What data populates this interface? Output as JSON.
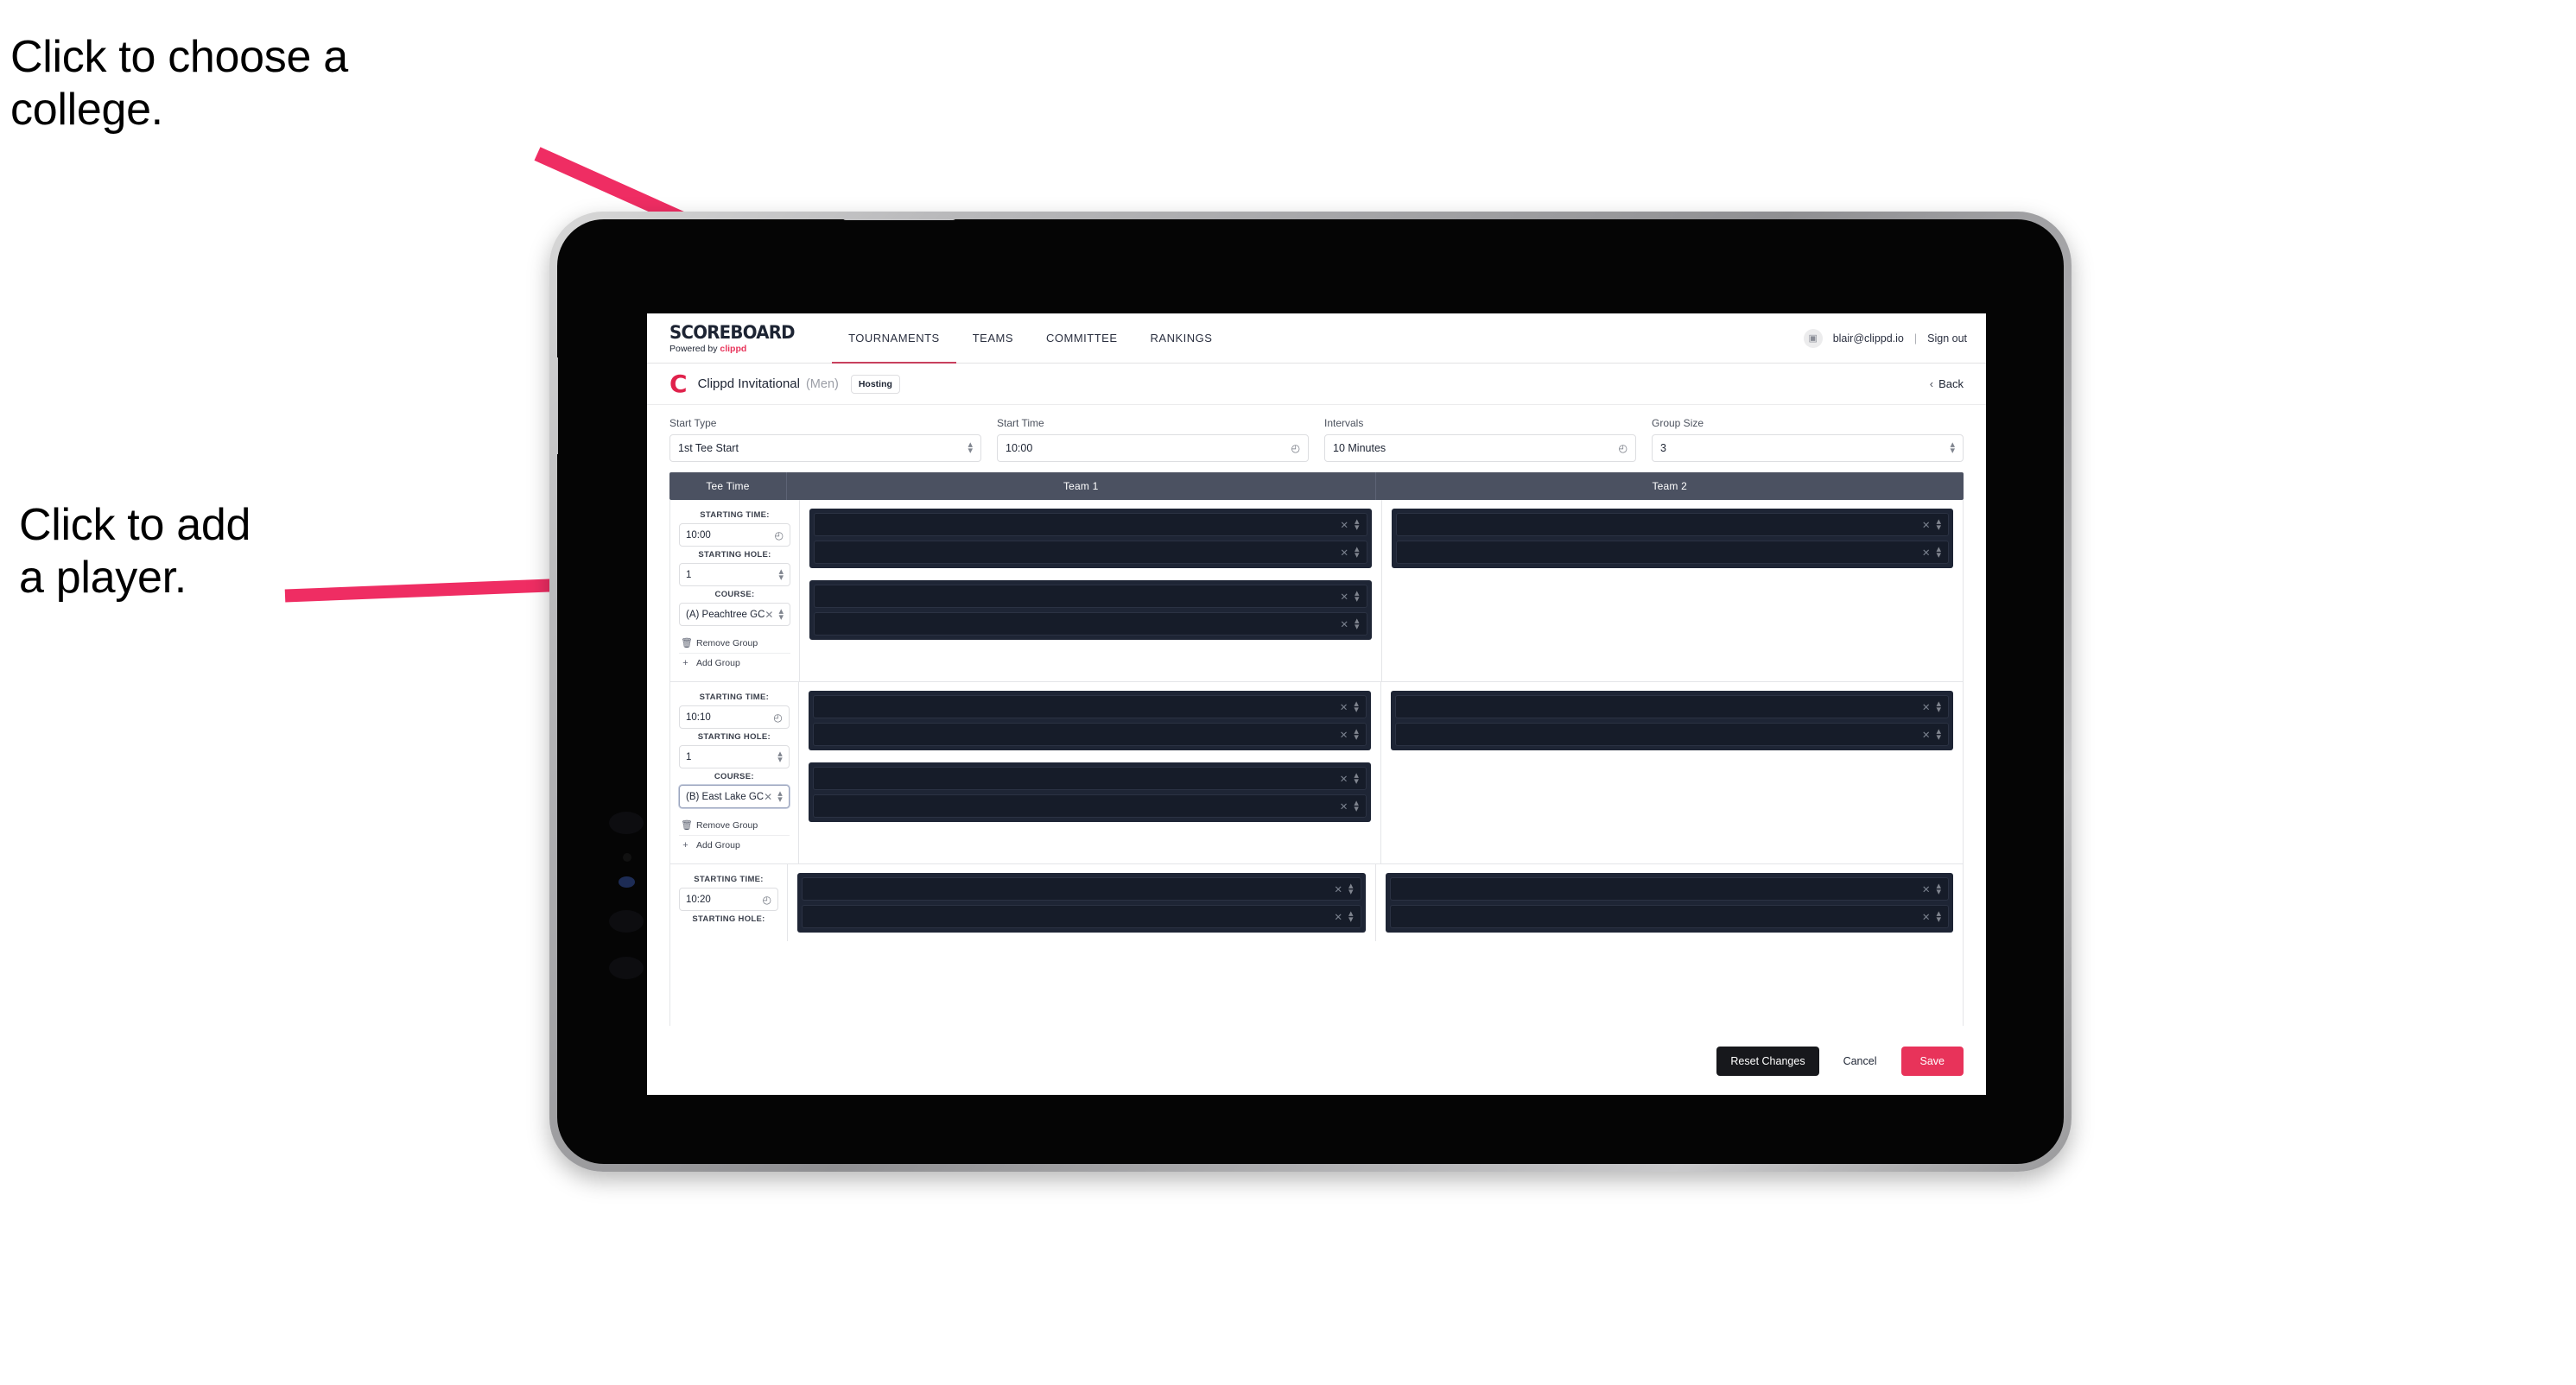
{
  "annotations": {
    "college": "Click to choose a\ncollege.",
    "player": "Click to add\na player."
  },
  "colors": {
    "accent_pink": "#e8335a",
    "arrow_pink": "#ef2d63",
    "header_slate": "#4b5161",
    "player_row_dark": "#161c29",
    "dark_button": "#17181c"
  },
  "topnav": {
    "brand_word": "SCOREBOARD",
    "brand_sub_prefix": "Powered by ",
    "brand_sub_mark": "clippd",
    "tabs": [
      {
        "label": "TOURNAMENTS",
        "active": true
      },
      {
        "label": "TEAMS",
        "active": false
      },
      {
        "label": "COMMITTEE",
        "active": false
      },
      {
        "label": "RANKINGS",
        "active": false
      }
    ],
    "avatar_icon": "user-avatar-icon",
    "account_email": "blair@clippd.io",
    "separator": "|",
    "sign_out": "Sign out"
  },
  "subheader": {
    "logo_mark": "C",
    "tournament_name": "Clippd Invitational",
    "gender": "(Men)",
    "hosting_badge": "Hosting",
    "back_chevron": "‹",
    "back_label": "Back"
  },
  "settings": [
    {
      "label": "Start Type",
      "value": "1st Tee Start",
      "icon": "stepper-icon"
    },
    {
      "label": "Start Time",
      "value": "10:00",
      "icon": "clock-icon"
    },
    {
      "label": "Intervals",
      "value": "10 Minutes",
      "icon": "clock-icon"
    },
    {
      "label": "Group Size",
      "value": "3",
      "icon": "stepper-icon"
    }
  ],
  "table": {
    "headers": [
      "Tee Time",
      "Team 1",
      "Team 2"
    ],
    "field_labels": {
      "starting_time": "STARTING TIME:",
      "starting_hole": "STARTING HOLE:",
      "course": "COURSE:"
    },
    "actions": {
      "remove_group": "Remove Group",
      "remove_icon": "trash-icon",
      "add_group": "Add Group",
      "add_icon": "plus-icon"
    },
    "groups": [
      {
        "starting_time": "10:00",
        "starting_hole": "1",
        "course": "(A) Peachtree GC",
        "course_focused": false,
        "team1_blocks": [
          2,
          2
        ],
        "team2_blocks": [
          2
        ]
      },
      {
        "starting_time": "10:10",
        "starting_hole": "1",
        "course": "(B) East Lake GC",
        "course_focused": true,
        "team1_blocks": [
          2,
          2
        ],
        "team2_blocks": [
          2
        ]
      },
      {
        "starting_time": "10:20",
        "starting_hole": "",
        "course": "",
        "course_focused": false,
        "team1_blocks": [
          2
        ],
        "team2_blocks": [
          2
        ]
      }
    ]
  },
  "footer": {
    "reset_changes": "Reset Changes",
    "cancel": "Cancel",
    "save": "Save"
  }
}
